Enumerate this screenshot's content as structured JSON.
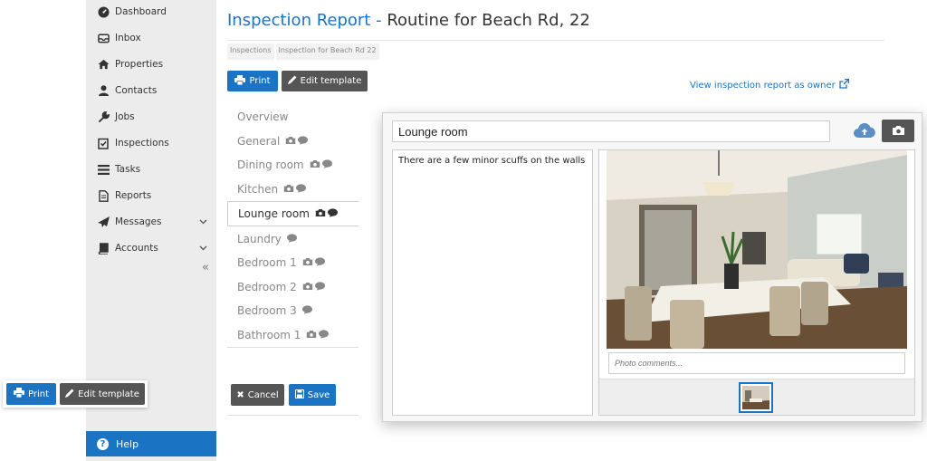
{
  "sidebar": {
    "items": [
      {
        "label": "Dashboard",
        "icon": "tachometer-icon"
      },
      {
        "label": "Inbox",
        "icon": "inbox-icon"
      },
      {
        "label": "Properties",
        "icon": "home-icon"
      },
      {
        "label": "Contacts",
        "icon": "user-icon"
      },
      {
        "label": "Jobs",
        "icon": "wrench-icon"
      },
      {
        "label": "Inspections",
        "icon": "checkbox-icon"
      },
      {
        "label": "Tasks",
        "icon": "list-icon"
      },
      {
        "label": "Reports",
        "icon": "file-icon"
      },
      {
        "label": "Messages",
        "icon": "paper-plane-icon"
      },
      {
        "label": "Accounts",
        "icon": "book-icon"
      }
    ],
    "collapse_glyph": "«",
    "help_label": "Help"
  },
  "header": {
    "title_prefix": "Inspection Report - ",
    "title_main": "Routine for Beach Rd, 22",
    "breadcrumbs": [
      "Inspections",
      "Inspection for Beach Rd 22"
    ]
  },
  "toolbar": {
    "print_label": "Print",
    "edit_template_label": "Edit template",
    "owner_link": "View inspection report as owner"
  },
  "rooms": [
    {
      "label": "Overview",
      "camera": false,
      "comment": false
    },
    {
      "label": "General",
      "camera": true,
      "comment": true
    },
    {
      "label": "Dining room",
      "camera": true,
      "comment": true
    },
    {
      "label": "Kitchen",
      "camera": true,
      "comment": true
    },
    {
      "label": "Lounge room",
      "camera": true,
      "comment": true,
      "active": true
    },
    {
      "label": "Laundry",
      "camera": false,
      "comment": true
    },
    {
      "label": "Bedroom 1",
      "camera": true,
      "comment": true
    },
    {
      "label": "Bedroom 2",
      "camera": true,
      "comment": true
    },
    {
      "label": "Bedroom 3",
      "camera": false,
      "comment": true
    },
    {
      "label": "Bathroom 1",
      "camera": true,
      "comment": true
    }
  ],
  "form": {
    "cancel_label": "Cancel",
    "save_label": "Save"
  },
  "panel": {
    "room_name": "Lounge room",
    "notes": "There are a few minor scuffs on the walls",
    "photo_comments_placeholder": "Photo comments..."
  },
  "colors": {
    "accent": "#1a73c3",
    "dark_button": "#555555",
    "sidebar_bg": "#ececec"
  }
}
